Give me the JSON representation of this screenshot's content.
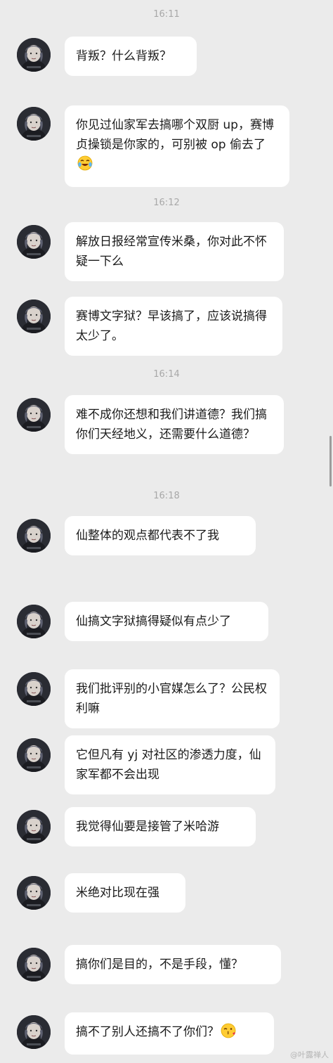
{
  "timestamps": [
    "16:11",
    "16:12",
    "16:14",
    "16:18"
  ],
  "messages": [
    {
      "text": "背叛？什么背叛？"
    },
    {
      "text": "你见过仙家军去搞哪个双厨 up，赛博贞操锁是你家的，可别被 op 偷去了",
      "emoji": "tears-of-joy-emoji"
    },
    {
      "text": "解放日报经常宣传米桑，你对此不怀疑一下么"
    },
    {
      "text": "赛博文字狱？早该搞了，应该说搞得太少了。"
    },
    {
      "text": "难不成你还想和我们讲道德？我们搞你们天经地义，还需要什么道德？"
    },
    {
      "text": "仙整体的观点都代表不了我"
    },
    {
      "text": "仙搞文字狱搞得疑似有点少了"
    },
    {
      "text": "我们批评别的小官媒怎么了？公民权利嘛"
    },
    {
      "text": "它但凡有 yj 对社区的渗透力度，仙家军都不会出现"
    },
    {
      "text": "我觉得仙要是接管了米哈游"
    },
    {
      "text": "米绝对比现在强"
    },
    {
      "text": "搞你们是目的，不是手段，懂？"
    },
    {
      "text": "搞不了别人还搞不了你们？",
      "emoji": "kiss-wink-emoji"
    }
  ],
  "watermark": "@叶露禅人",
  "colors": {
    "background": "#ebebeb",
    "bubble": "#ffffff",
    "timestamp": "#a8a8a8"
  }
}
